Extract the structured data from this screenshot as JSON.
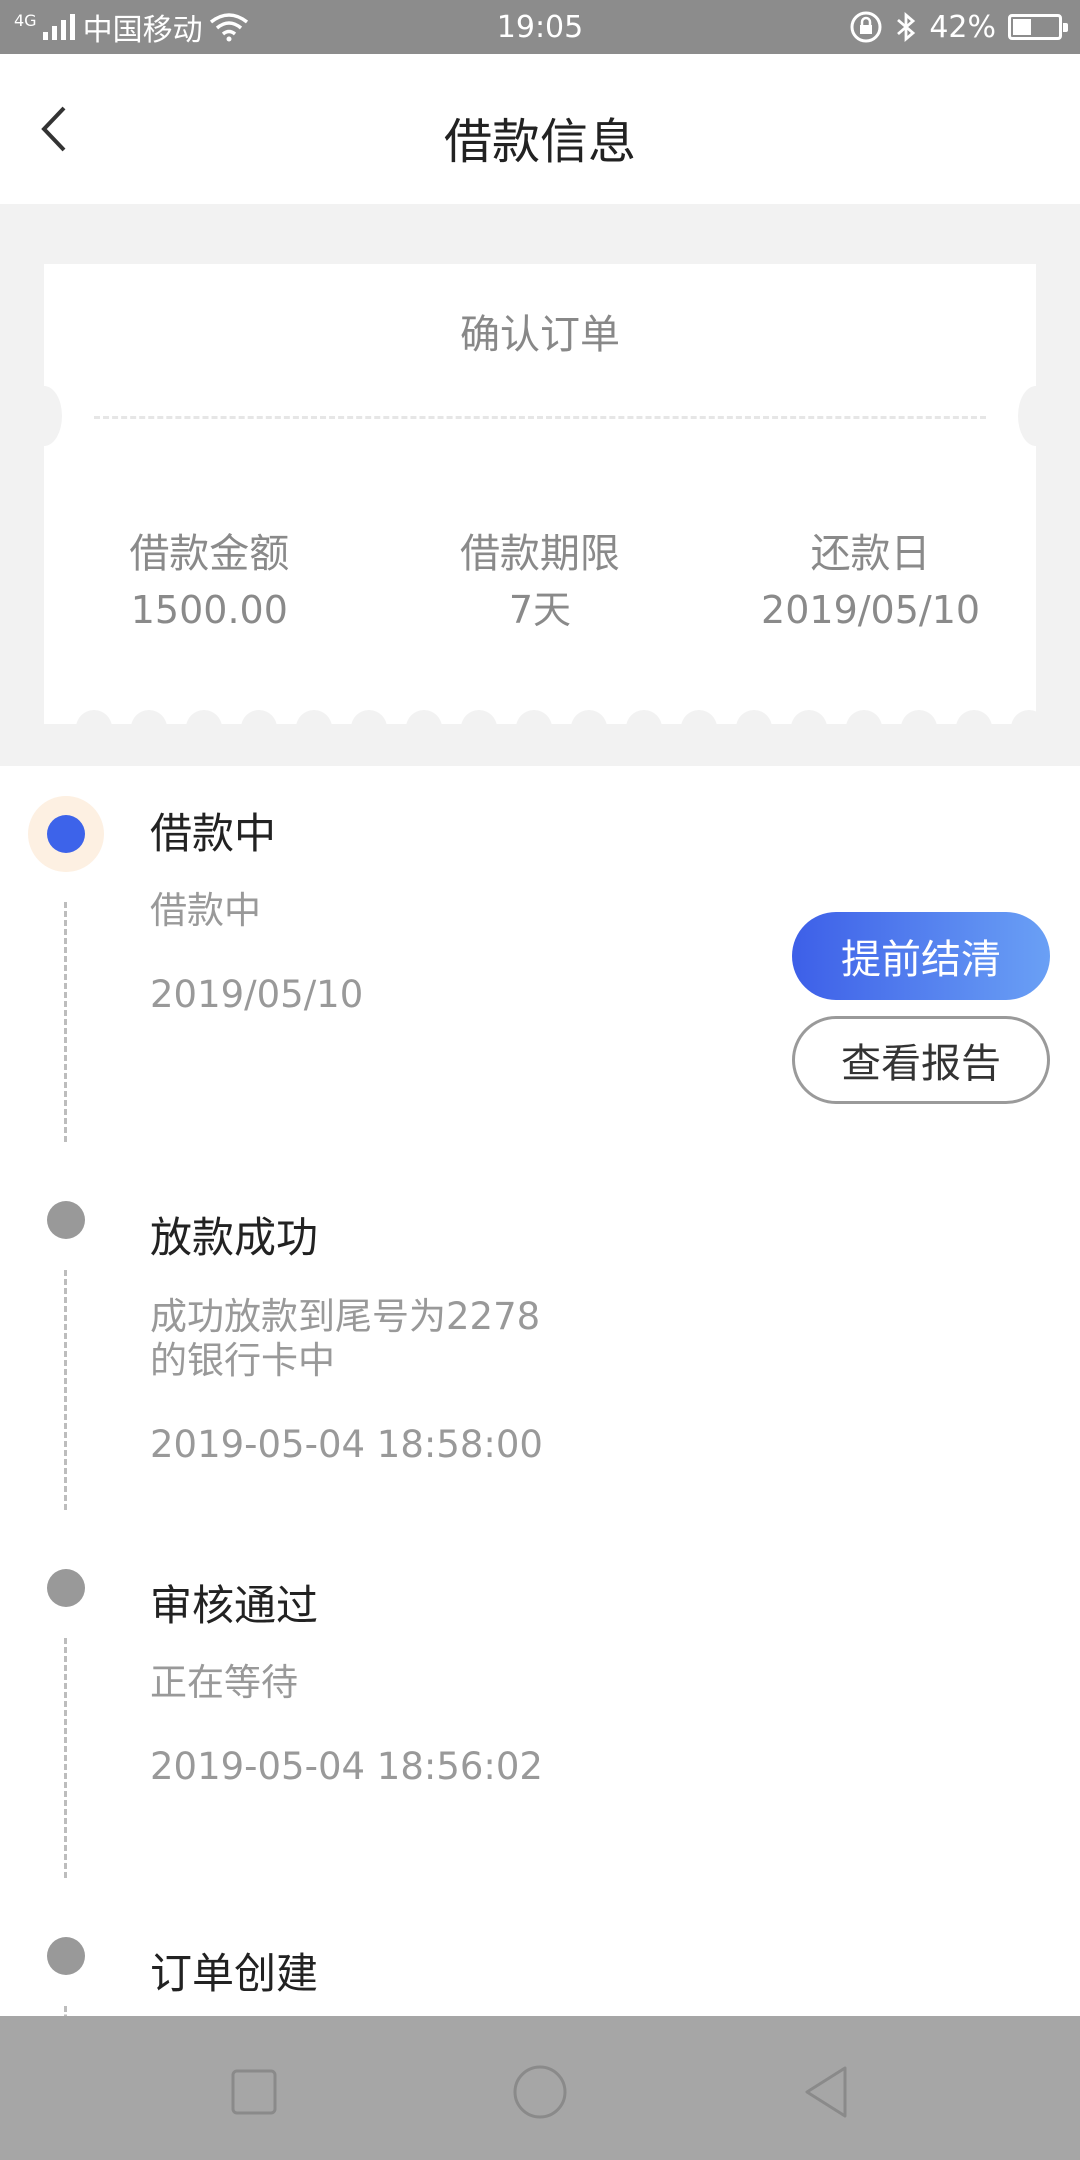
{
  "status_bar": {
    "network": "4G",
    "carrier": "中国移动",
    "time": "19:05",
    "battery_percent": "42%",
    "battery_level": 0.42,
    "icons": [
      "signal-icon",
      "wifi-icon",
      "rotation-lock-icon",
      "bluetooth-icon",
      "battery-icon"
    ]
  },
  "header": {
    "title": "借款信息",
    "back_icon": "chevron-left-icon"
  },
  "ticket": {
    "title": "确认订单",
    "columns": [
      {
        "label": "借款金额",
        "value": "1500.00"
      },
      {
        "label": "借款期限",
        "value": "7天"
      },
      {
        "label": "还款日",
        "value": "2019/05/10"
      }
    ]
  },
  "timeline": [
    {
      "title": "借款中",
      "subtitle": "借款中",
      "time": "2019/05/10",
      "active": true
    },
    {
      "title": "放款成功",
      "subtitle_line1": "成功放款到尾号为2278",
      "subtitle_line2": "的银行卡中",
      "time": "2019-05-04 18:58:00",
      "active": false
    },
    {
      "title": "审核通过",
      "subtitle": "正在等待",
      "time": "2019-05-04 18:56:02",
      "active": false
    },
    {
      "title": "订单创建",
      "active": false
    }
  ],
  "actions": {
    "primary_label": "提前结清",
    "secondary_label": "查看报告"
  },
  "colors": {
    "accent": "#3d63ea",
    "accent_gradient_end": "#6aa0f5",
    "active_halo": "#fdf0e2",
    "status_bar": "#8c8c8c",
    "nav_bar": "#a6a6a6"
  },
  "nav_bar": {
    "icons": [
      "square-icon",
      "circle-icon",
      "triangle-back-icon"
    ]
  }
}
